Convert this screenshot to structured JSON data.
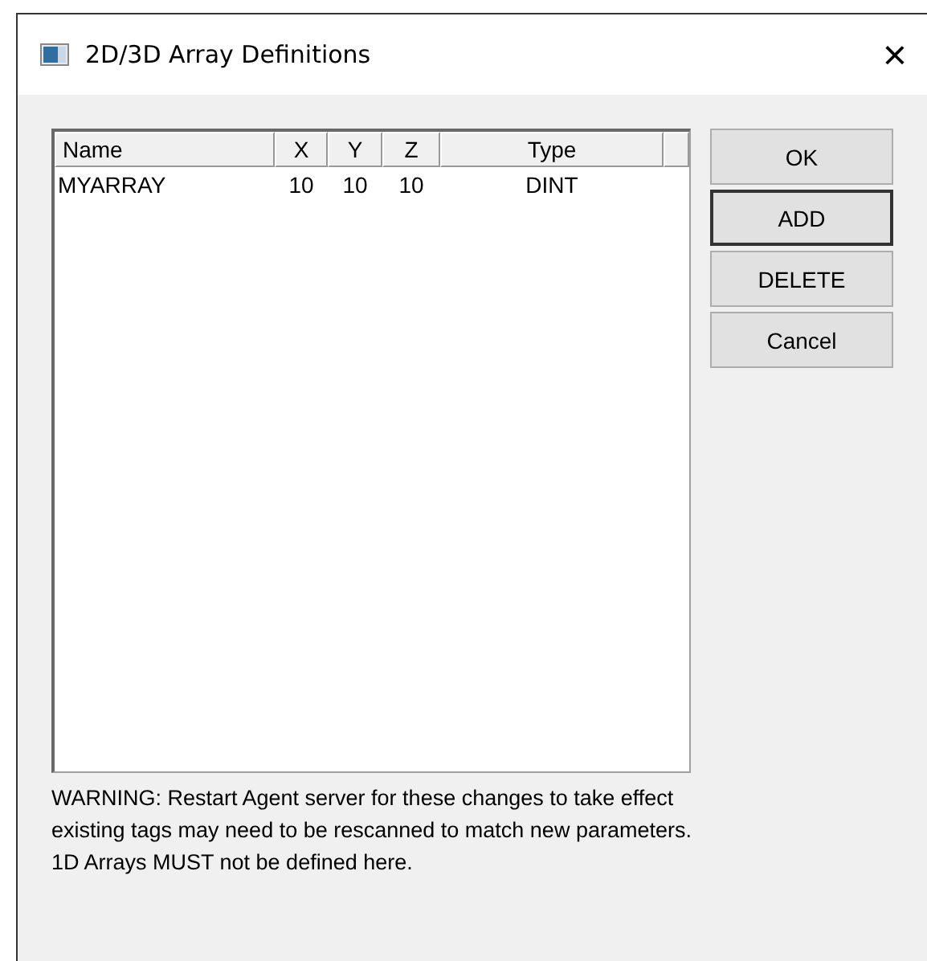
{
  "window": {
    "title": "2D/3D Array Definitions",
    "close": "×"
  },
  "list": {
    "columns": [
      "Name",
      "X",
      "Y",
      "Z",
      "Type"
    ],
    "rows": [
      [
        "MYARRAY",
        "10",
        "10",
        "10",
        "DINT"
      ]
    ]
  },
  "buttons": [
    {
      "label": "OK",
      "default": false
    },
    {
      "label": "ADD",
      "default": true
    },
    {
      "label": "DELETE",
      "default": false
    },
    {
      "label": "Cancel",
      "default": false
    }
  ],
  "messages": [
    "WARNING: Restart Agent server for these changes to take effect",
    "existing tags may need to be rescanned to match new parameters.",
    "1D Arrays MUST not be defined here."
  ]
}
